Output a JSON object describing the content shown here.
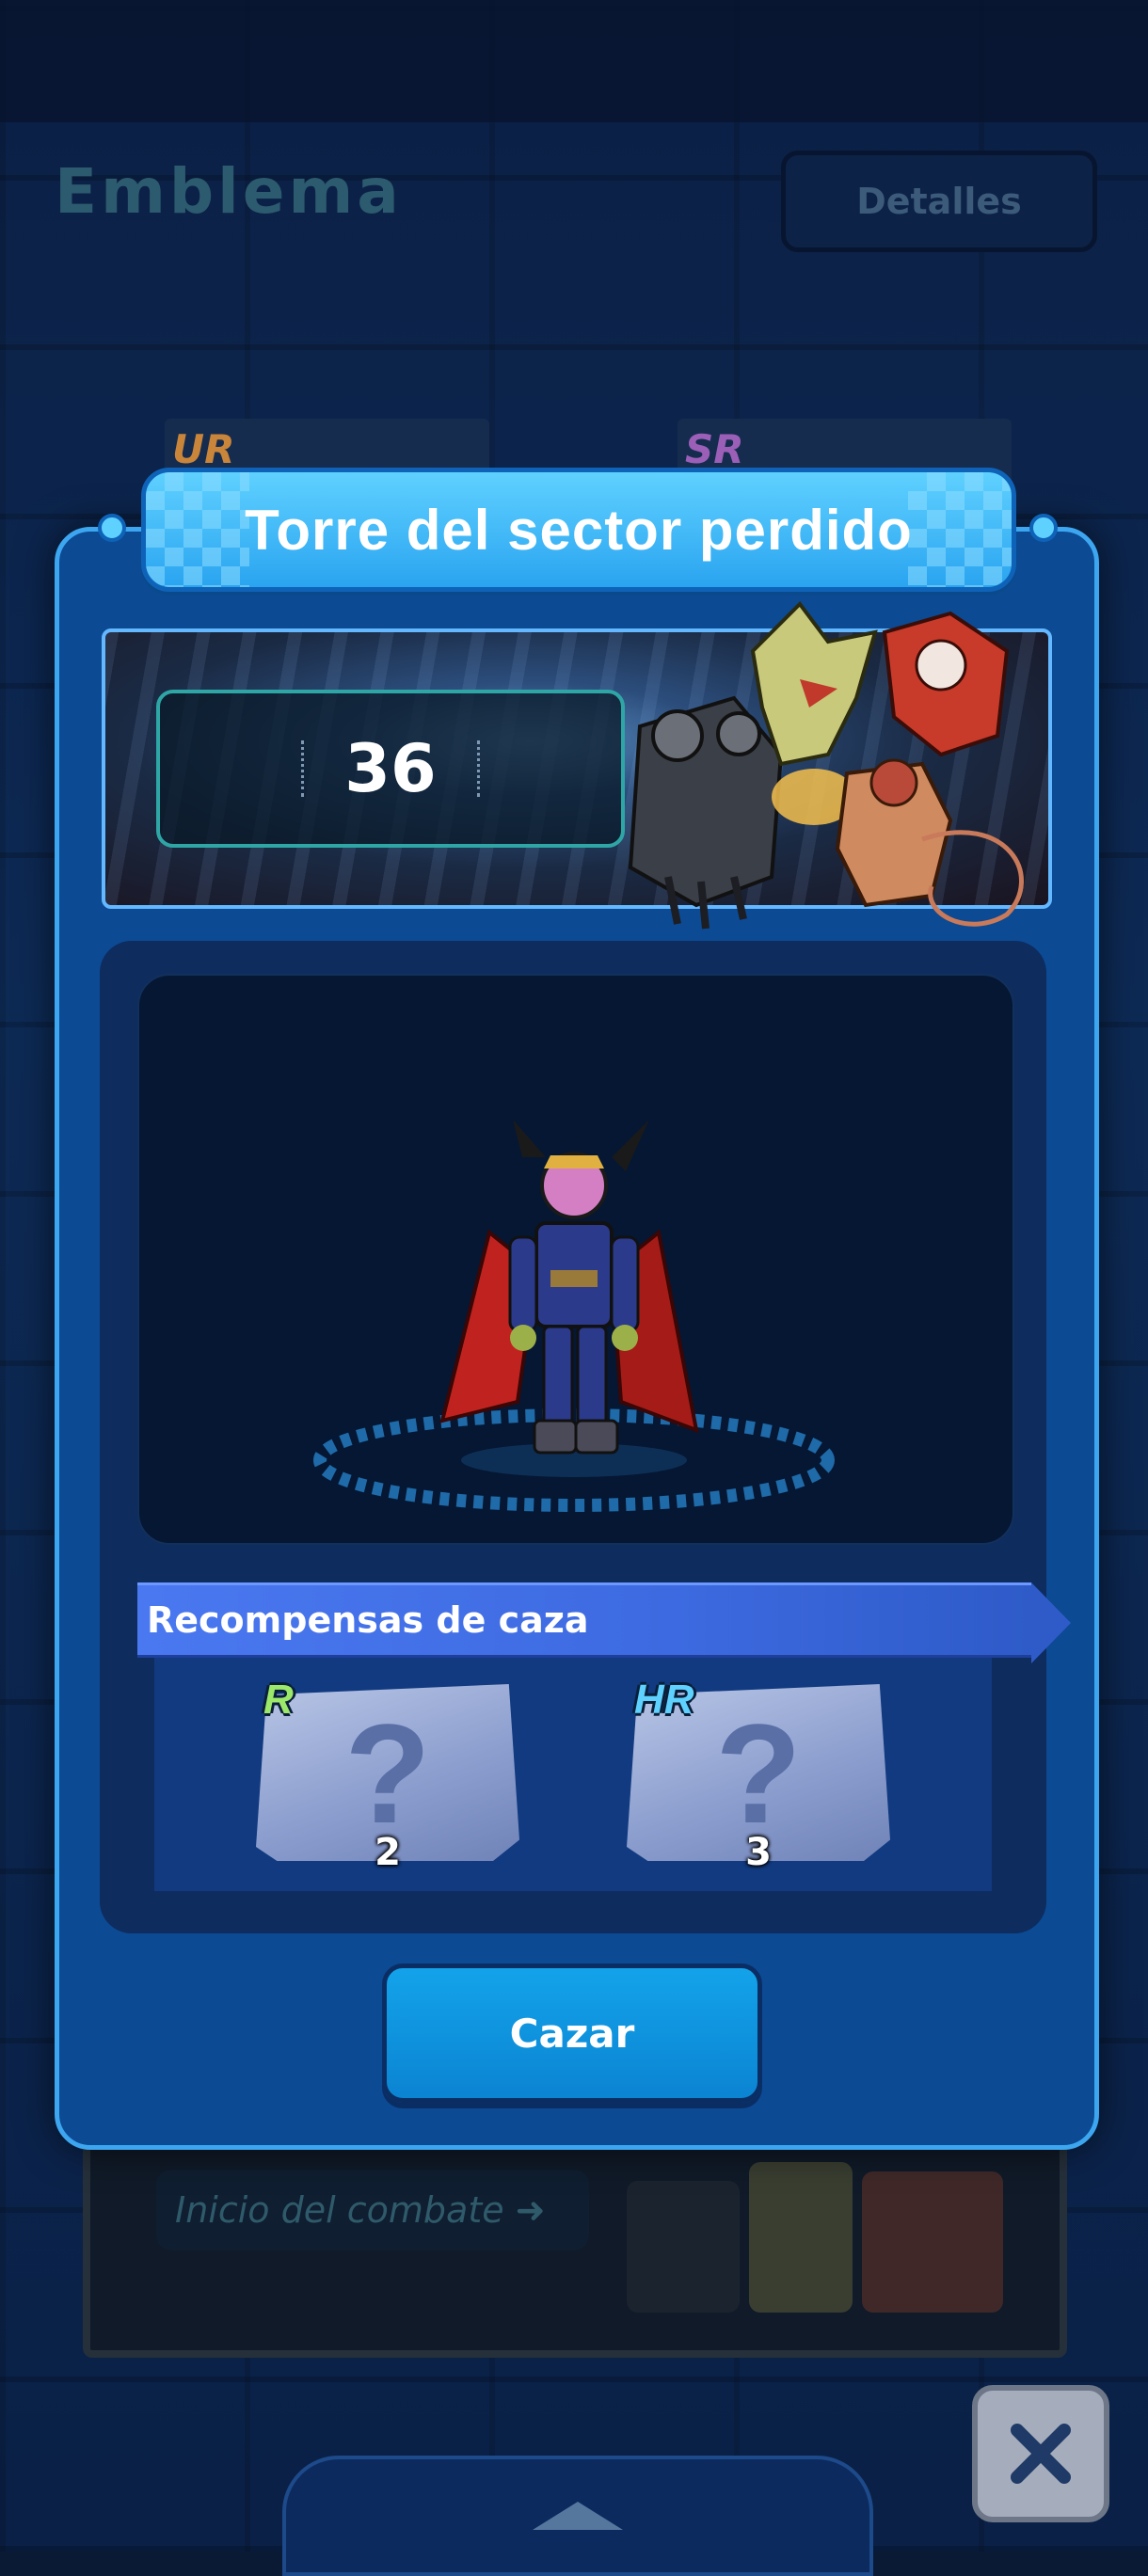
{
  "background": {
    "title": "Emblema",
    "details_button": "Detalles",
    "card_tags": [
      "UR",
      "SR"
    ],
    "start_battle_button": "Inicio del combate ➜"
  },
  "modal": {
    "title": "Torre del sector perdido",
    "counter_value": "36",
    "rewards_header": "Recompensas de caza",
    "rewards": [
      {
        "rarity": "R",
        "count": "2",
        "rarity_color": "#9be86b"
      },
      {
        "rarity": "HR",
        "count": "3",
        "rarity_color": "#5fd1ff"
      }
    ],
    "hunt_button": "Cazar"
  },
  "colors": {
    "modal_bg": "#0c4a94",
    "title_bar": "#2aa4f0",
    "hunt_button": "#0b84d2",
    "reward_strip": "#3d6ae0"
  },
  "icons": {
    "close": "close-icon",
    "expand": "chevron-up-icon",
    "reward_unknown": "question-mark-icon"
  }
}
